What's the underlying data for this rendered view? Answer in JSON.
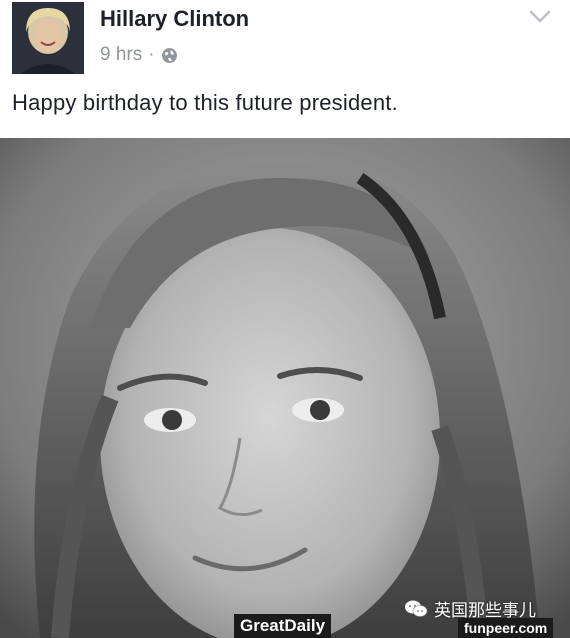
{
  "post": {
    "author_name": "Hillary Clinton",
    "timestamp": "9 hrs",
    "separator": "·",
    "privacy_icon": "globe-icon",
    "menu_icon": "chevron-down-icon",
    "status_text": "Happy birthday to this future president."
  },
  "photo": {
    "description_icon": "portrait-photo"
  },
  "watermarks": {
    "wechat_account": "英国那些事儿",
    "greatdaily": "GreatDaily",
    "funpeer": "funpeer.com"
  },
  "colors": {
    "name_text": "#1d2129",
    "meta_text": "#90949c",
    "background": "#ffffff"
  }
}
